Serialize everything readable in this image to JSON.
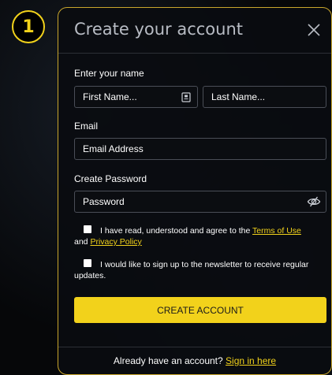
{
  "step_badge": "1",
  "modal": {
    "title": "Create your account",
    "close_icon": "close-icon"
  },
  "name_section": {
    "label": "Enter your name",
    "first_name_placeholder": "First Name...",
    "last_name_placeholder": "Last Name...",
    "autofill_icon": "id-card-icon"
  },
  "email_section": {
    "label": "Email",
    "placeholder": "Email Address"
  },
  "password_section": {
    "label": "Create Password",
    "placeholder": "Password",
    "visibility_icon": "eye-slash-icon"
  },
  "terms": {
    "text_before": "I have read, understood and agree to the ",
    "terms_link": "Terms of Use",
    "and_text": "and ",
    "privacy_link": "Privacy Policy",
    "checked": false
  },
  "newsletter": {
    "text_line1": "I would like to sign up to the newsletter to receive regular",
    "text_line2": "updates.",
    "checked": false
  },
  "create_button": "CREATE ACCOUNT",
  "footer": {
    "text": "Already have an account? ",
    "sign_in_link": "Sign in here"
  },
  "colors": {
    "accent": "#f2d21b",
    "modal_border": "#c9a62c",
    "background": "#050608"
  }
}
